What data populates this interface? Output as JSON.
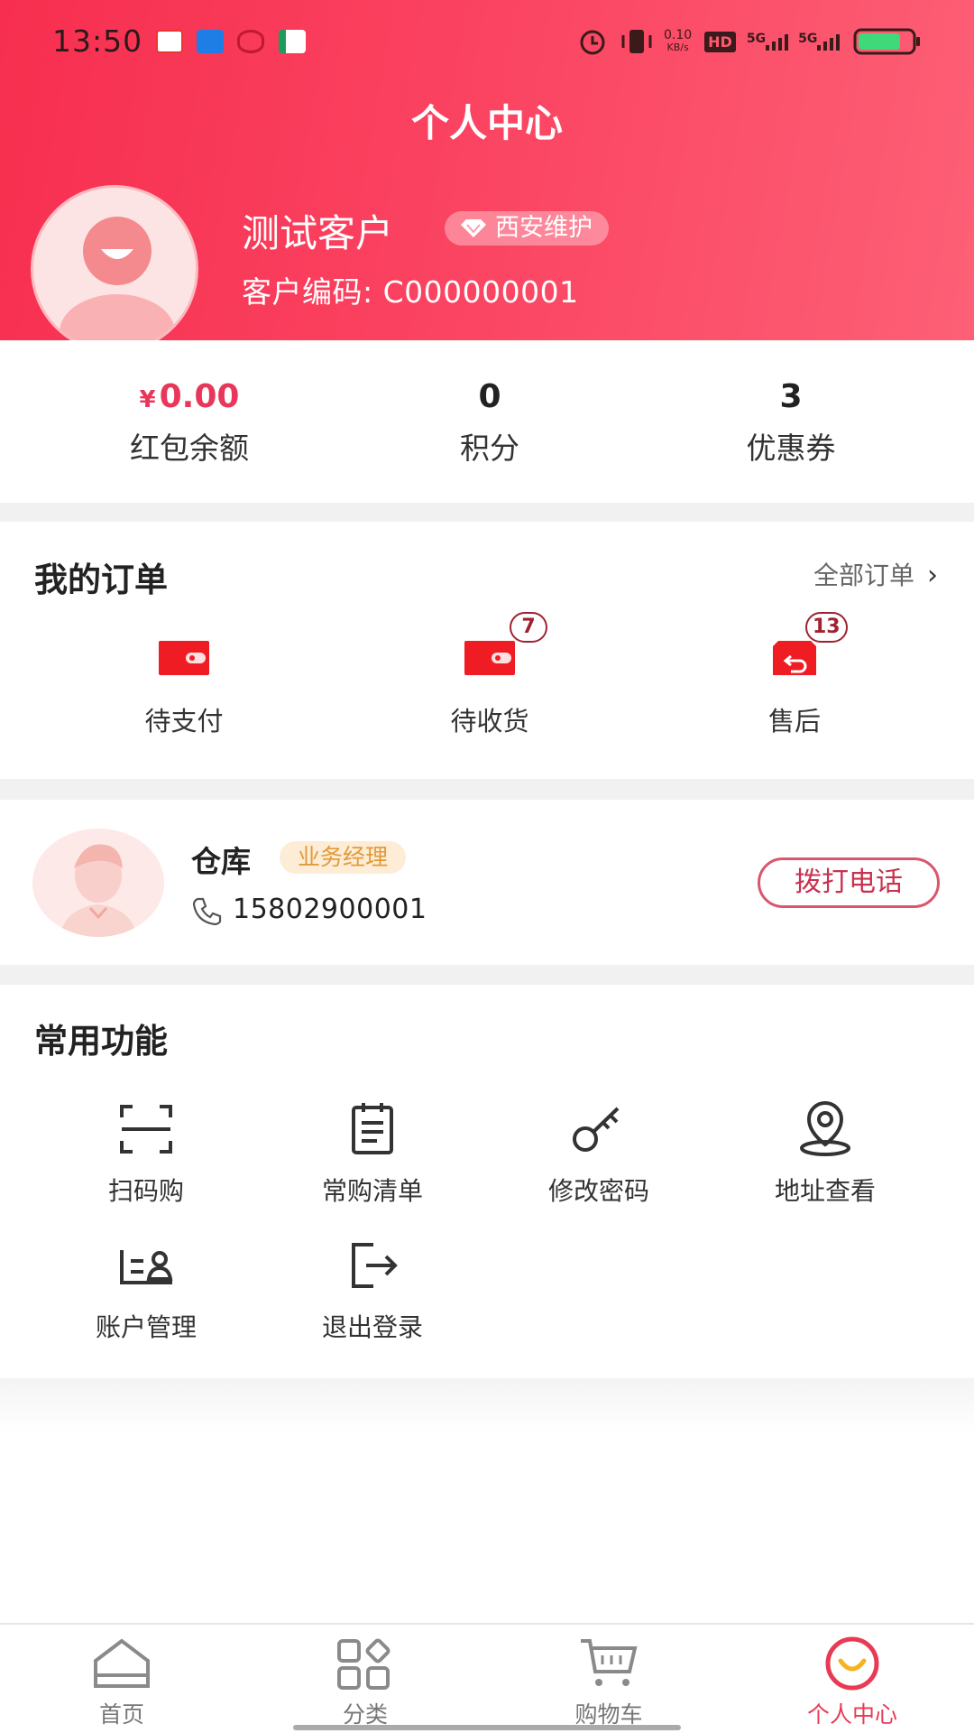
{
  "status_bar": {
    "time": "13:50",
    "net_speed": "0.10",
    "net_unit": "KB/s",
    "hd": "HD",
    "sim1": "5G",
    "sim2": "5G",
    "battery_color": "#3ed978"
  },
  "header": {
    "title": "个人中心",
    "user_name": "测试客户",
    "badge": "西安维护",
    "customer_code": "客户编码: C000000001"
  },
  "stats": [
    {
      "currency": "¥",
      "value": "0.00",
      "label": "红包余额"
    },
    {
      "value": "0",
      "label": "积分"
    },
    {
      "value": "3",
      "label": "优惠券"
    }
  ],
  "orders": {
    "title": "我的订单",
    "all_orders": "全部订单",
    "items": [
      {
        "label": "待支付",
        "badge": null
      },
      {
        "label": "待收货",
        "badge": "7"
      },
      {
        "label": "售后",
        "badge": "13"
      }
    ]
  },
  "contact": {
    "name": "仓库",
    "role": "业务经理",
    "phone": "15802900001",
    "call_button": "拨打电话"
  },
  "functions": {
    "title": "常用功能",
    "items": [
      {
        "label": "扫码购",
        "icon": "scan-icon"
      },
      {
        "label": "常购清单",
        "icon": "list-icon"
      },
      {
        "label": "修改密码",
        "icon": "key-icon"
      },
      {
        "label": "地址查看",
        "icon": "location-icon"
      },
      {
        "label": "账户管理",
        "icon": "account-icon"
      },
      {
        "label": "退出登录",
        "icon": "logout-icon"
      }
    ]
  },
  "bottom_nav": {
    "items": [
      {
        "label": "首页",
        "icon": "home-icon"
      },
      {
        "label": "分类",
        "icon": "category-icon"
      },
      {
        "label": "购物车",
        "icon": "cart-icon"
      },
      {
        "label": "个人中心",
        "icon": "profile-icon",
        "active": true
      }
    ]
  },
  "colors": {
    "brand": "#f72e4f",
    "accent": "#e83a55",
    "order_icon": "#f01c24"
  }
}
